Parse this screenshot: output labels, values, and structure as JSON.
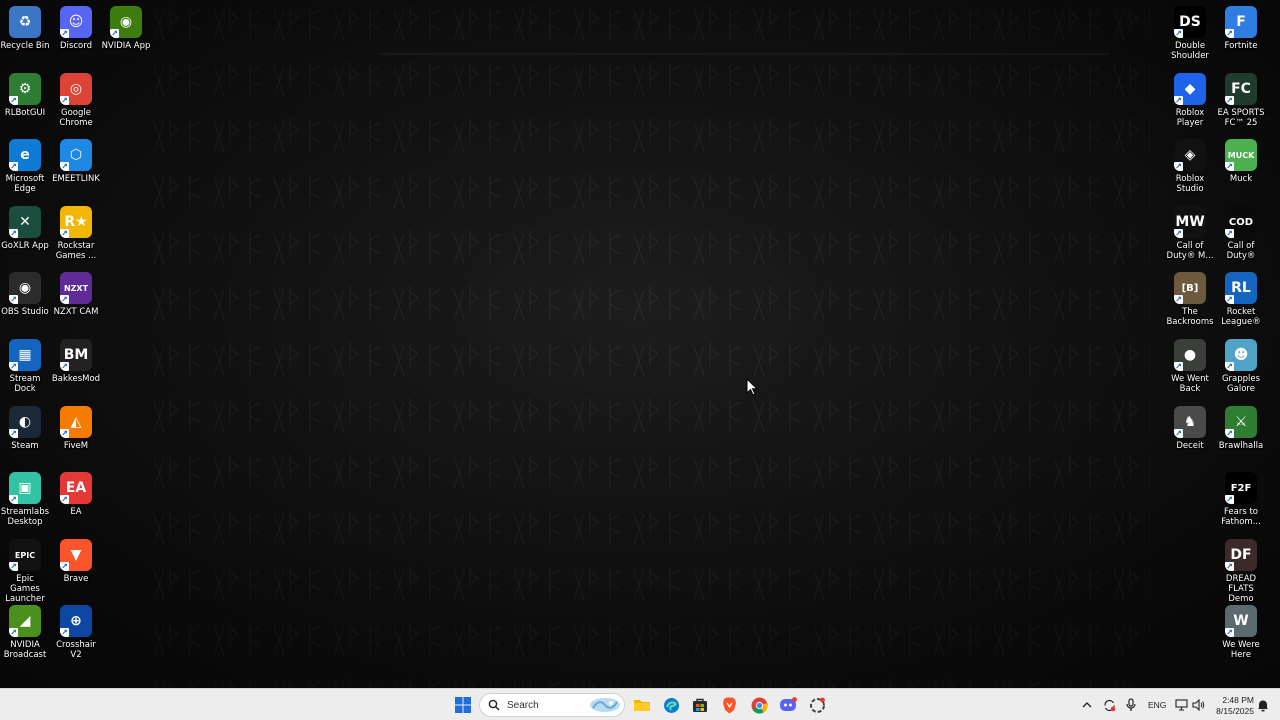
{
  "desktop": {
    "left_col1": [
      {
        "label": "Recycle Bin",
        "icon": "recycle-bin-icon",
        "color": "#3a76c4",
        "glyph": "♻",
        "shortcut": false
      },
      {
        "label": "RLBotGUI",
        "icon": "rlbotgui-icon",
        "color": "#2e7d32",
        "glyph": "⚙",
        "shortcut": true
      },
      {
        "label": "Microsoft Edge",
        "icon": "edge-icon",
        "color": "#0f7bd6",
        "glyph": "e",
        "shortcut": true
      },
      {
        "label": "GoXLR App",
        "icon": "goxlr-icon",
        "color": "#1b4d3e",
        "glyph": "✕",
        "shortcut": true
      },
      {
        "label": "OBS Studio",
        "icon": "obs-icon",
        "color": "#2b2b2b",
        "glyph": "◉",
        "shortcut": true
      },
      {
        "label": "Stream Dock",
        "icon": "stream-dock-icon",
        "color": "#1565c0",
        "glyph": "▦",
        "shortcut": true
      },
      {
        "label": "Steam",
        "icon": "steam-icon",
        "color": "#1b2838",
        "glyph": "◐",
        "shortcut": true
      },
      {
        "label": "Streamlabs Desktop",
        "icon": "streamlabs-icon",
        "color": "#31c3a2",
        "glyph": "▣",
        "shortcut": true
      },
      {
        "label": "Epic Games Launcher",
        "icon": "epic-games-icon",
        "color": "#111111",
        "glyph": "EPIC",
        "shortcut": true
      },
      {
        "label": "NVIDIA Broadcast",
        "icon": "nvidia-broadcast-icon",
        "color": "#4b8f1d",
        "glyph": "◢",
        "shortcut": true
      }
    ],
    "left_col2": [
      {
        "label": "Discord",
        "icon": "discord-icon",
        "color": "#5865f2",
        "glyph": "☺",
        "shortcut": true
      },
      {
        "label": "Google Chrome",
        "icon": "chrome-icon",
        "color": "#db4437",
        "glyph": "◎",
        "shortcut": true
      },
      {
        "label": "EMEETLINK",
        "icon": "emeetlink-icon",
        "color": "#1e88e5",
        "glyph": "⬡",
        "shortcut": true
      },
      {
        "label": "Rockstar Games ...",
        "icon": "rockstar-icon",
        "color": "#f2b705",
        "glyph": "R★",
        "shortcut": true
      },
      {
        "label": "NZXT CAM",
        "icon": "nzxt-cam-icon",
        "color": "#5e2b97",
        "glyph": "NZXT",
        "shortcut": true
      },
      {
        "label": "BakkesMod",
        "icon": "bakkesmod-icon",
        "color": "#222222",
        "glyph": "BM",
        "shortcut": true
      },
      {
        "label": "FiveM",
        "icon": "fivem-icon",
        "color": "#f57c00",
        "glyph": "◭",
        "shortcut": true
      },
      {
        "label": "EA",
        "icon": "ea-icon",
        "color": "#e53935",
        "glyph": "EA",
        "shortcut": true
      },
      {
        "label": "Brave",
        "icon": "brave-icon",
        "color": "#fb542b",
        "glyph": "▼",
        "shortcut": true
      },
      {
        "label": "Crosshair V2",
        "icon": "crosshair-icon",
        "color": "#0d47a1",
        "glyph": "⊕",
        "shortcut": true
      }
    ],
    "left_col3": [
      {
        "label": "NVIDIA App",
        "icon": "nvidia-app-icon",
        "color": "#3c7d0e",
        "glyph": "◉",
        "shortcut": true
      }
    ],
    "right_col1": [
      {
        "label": "Double Shoulder",
        "icon": "double-shoulder-icon",
        "color": "#000000",
        "glyph": "DS",
        "shortcut": true
      },
      {
        "label": "Roblox Player",
        "icon": "roblox-player-icon",
        "color": "#1e63e9",
        "glyph": "◆",
        "shortcut": true
      },
      {
        "label": "Roblox Studio",
        "icon": "roblox-studio-icon",
        "color": "#111111",
        "glyph": "◈",
        "shortcut": true
      },
      {
        "label": "Call of Duty® M...",
        "icon": "cod-mw-icon",
        "color": "#111111",
        "glyph": "MW",
        "shortcut": true
      },
      {
        "label": "The Backrooms",
        "icon": "backrooms-icon",
        "color": "#6d5a3c",
        "glyph": "[B]",
        "shortcut": true
      },
      {
        "label": "We Went Back",
        "icon": "we-went-back-icon",
        "color": "#3a3f3a",
        "glyph": "●",
        "shortcut": true
      },
      {
        "label": "Deceit",
        "icon": "deceit-icon",
        "color": "#4a4a4a",
        "glyph": "♞",
        "shortcut": true
      }
    ],
    "right_col2": [
      {
        "label": "Fortnite",
        "icon": "fortnite-icon",
        "color": "#2f7de1",
        "glyph": "F",
        "shortcut": true
      },
      {
        "label": "EA SPORTS FC™ 25",
        "icon": "ea-sports-fc-icon",
        "color": "#1f3b2d",
        "glyph": "FC",
        "shortcut": true
      },
      {
        "label": "Muck",
        "icon": "muck-icon",
        "color": "#4caf50",
        "glyph": "MUCK",
        "shortcut": true
      },
      {
        "label": "Call of Duty®",
        "icon": "cod-icon",
        "color": "#0a0a0a",
        "glyph": "COD",
        "shortcut": true
      },
      {
        "label": "Rocket League®",
        "icon": "rocket-league-icon",
        "color": "#1565c0",
        "glyph": "RL",
        "shortcut": true
      },
      {
        "label": "Grapples Galore",
        "icon": "grapples-galore-icon",
        "color": "#4fa3c7",
        "glyph": "☻",
        "shortcut": true
      },
      {
        "label": "Brawlhalla",
        "icon": "brawlhalla-icon",
        "color": "#2e7d32",
        "glyph": "⚔",
        "shortcut": true
      },
      {
        "label": "Fears to Fathom...",
        "icon": "fears-to-fathom-icon",
        "color": "#000000",
        "glyph": "F2F",
        "shortcut": true
      },
      {
        "label": "DREAD FLATS Demo",
        "icon": "dread-flats-icon",
        "color": "#3a2a2a",
        "glyph": "DF",
        "shortcut": true
      },
      {
        "label": "We Were Here",
        "icon": "we-were-here-icon",
        "color": "#5a6a70",
        "glyph": "W",
        "shortcut": true
      }
    ]
  },
  "taskbar": {
    "search_label": "Search",
    "lang": "ENG",
    "time": "2:48 PM",
    "date": "8/15/2025",
    "bg_color": "#ededed"
  }
}
